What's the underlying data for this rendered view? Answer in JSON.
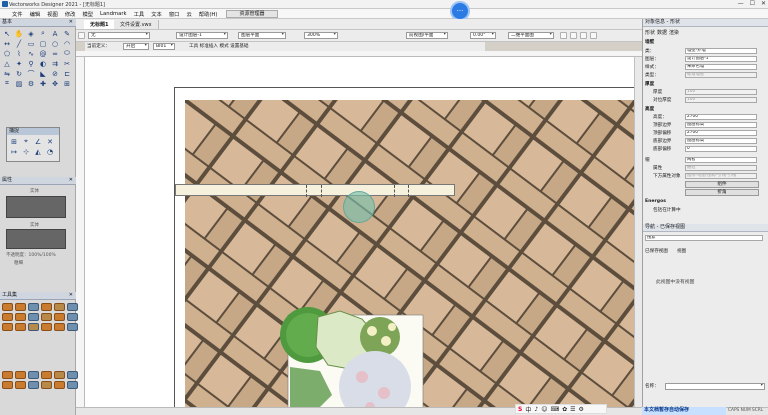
{
  "app": {
    "title": "Vectorworks Designer 2021 - [无标题1]",
    "window_buttons": [
      "—",
      "☐",
      "✕"
    ]
  },
  "menu": [
    "文件",
    "编辑",
    "视图",
    "修改",
    "模型",
    "Landmark",
    "工具",
    "文本",
    "窗口",
    "云",
    "帮助(H)"
  ],
  "doc_tabs": [
    {
      "label": "无标题1",
      "active": true
    },
    {
      "label": "文件设置.vwx",
      "active": false
    }
  ],
  "resource_manager_label": "资源管理器",
  "bubble_label": "···",
  "toolbar1": {
    "class_combo": "无",
    "layer_combo": "设计图层-1",
    "view_combo": "图层平面",
    "zoom_combo": "300%",
    "render_combo": "前视图/平面",
    "angle_value": "0.00°",
    "mode_combo": "二维平面图"
  },
  "toolbar2": {
    "mode_label": "当前定义：",
    "plane_combo": "开启",
    "hatch_combo": "BI01",
    "tool_label": "工具  标准插入  模式  设置基础",
    "options": [
      "工具",
      "标准插入",
      "模式",
      "设置翻转"
    ]
  },
  "left_panels": {
    "basic_title": "基本",
    "float_title": "捕捉",
    "attributes_title": "属性",
    "attr_fill": "实体",
    "attr_pen": "实体",
    "opacity_label": "不透明度：100%/100%",
    "lineweight_label": "粗细",
    "toolset_title": "工具集"
  },
  "right_panel": {
    "obj_info_title": "对象信息 - 形状",
    "tabs": [
      "形状",
      "数据",
      "渲染"
    ],
    "object_type": "墙壁",
    "rows": [
      {
        "label": "类：",
        "value": "墙壁-外墙"
      },
      {
        "label": "图层：",
        "value": "设计图层-1"
      },
      {
        "label": "样式：",
        "value": "未命名墙"
      },
      {
        "label": "类型：",
        "value": "标准墙壁"
      }
    ],
    "thickness_header": "厚度",
    "thickness_rows": [
      {
        "label": "厚度",
        "value": "100"
      },
      {
        "label": "对位厚度",
        "value": "100"
      }
    ],
    "height_header": "高度",
    "height_rows": [
      {
        "label": "高度：",
        "value": "2700"
      },
      {
        "label": "顶部边界",
        "value": "图层标高"
      },
      {
        "label": "顶部偏移",
        "value": "2700"
      },
      {
        "label": "底部边界",
        "value": "图层标高"
      },
      {
        "label": "底部偏移",
        "value": "0"
      }
    ],
    "cap_label": "帽",
    "cap_value": "两者",
    "cap_sub": "属性",
    "cap_sub_value": "通过",
    "lower_label": "下方属性对象",
    "lower_value": "图形-地图-图标-引线-引线",
    "components_button": "组件",
    "more_button": "折角",
    "energos_label": "Energos",
    "energos_check": "包括在计算中",
    "nav_title": "导航 - 已保存视图",
    "search_placeholder": "搜索",
    "nav_columns": [
      "已保存视图",
      "视图"
    ],
    "nav_empty": "此视图中没有视图",
    "name_label": "名称："
  },
  "status": {
    "autosave": "本文档暂存自动保存",
    "caps": "CAPS NUM SCRL"
  },
  "tray_icons": [
    "S",
    "中",
    "♪",
    "☺",
    "⌨",
    "✿",
    "☰",
    "⚙"
  ],
  "colors": {
    "paver_light": "#d7b99a",
    "paver_mid": "#c6a887",
    "paver_grout": "#5d4d3c",
    "wall_fill": "#f5f1dc",
    "cursor_glow": "#78beaa",
    "accent": "#2c7be5"
  }
}
